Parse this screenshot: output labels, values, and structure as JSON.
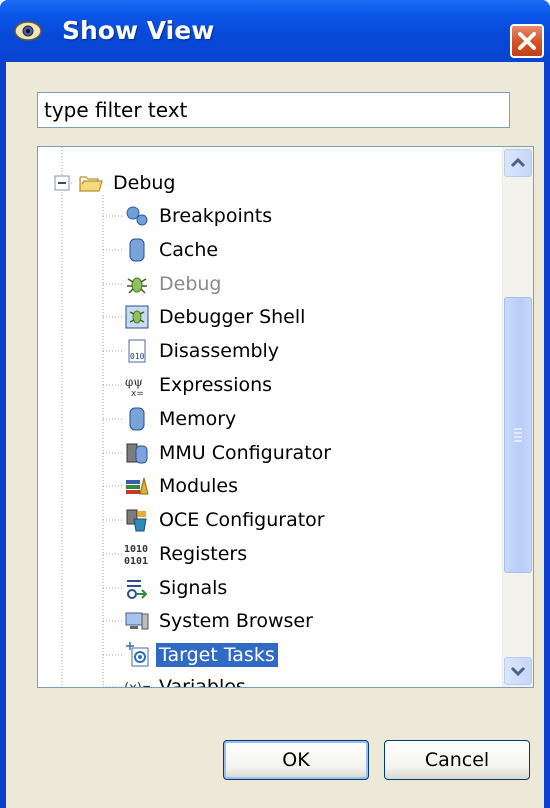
{
  "window": {
    "title": "Show View"
  },
  "filter": {
    "value": "type filter text"
  },
  "tree": {
    "root": "Debug",
    "items": [
      {
        "label": "Breakpoints",
        "icon": "breakpoints-icon"
      },
      {
        "label": "Cache",
        "icon": "cache-icon"
      },
      {
        "label": "Debug",
        "icon": "debug-bug-icon",
        "disabled": true
      },
      {
        "label": "Debugger Shell",
        "icon": "debugger-shell-icon"
      },
      {
        "label": "Disassembly",
        "icon": "disassembly-icon"
      },
      {
        "label": "Expressions",
        "icon": "expressions-icon"
      },
      {
        "label": "Memory",
        "icon": "memory-icon"
      },
      {
        "label": "MMU Configurator",
        "icon": "mmu-configurator-icon"
      },
      {
        "label": "Modules",
        "icon": "modules-icon"
      },
      {
        "label": "OCE Configurator",
        "icon": "oce-configurator-icon"
      },
      {
        "label": "Registers",
        "icon": "registers-icon"
      },
      {
        "label": "Signals",
        "icon": "signals-icon"
      },
      {
        "label": "System Browser",
        "icon": "system-browser-icon"
      },
      {
        "label": "Target Tasks",
        "icon": "target-tasks-icon",
        "selected": true
      },
      {
        "label": "Variables",
        "icon": "variables-icon"
      }
    ]
  },
  "buttons": {
    "ok": "OK",
    "cancel": "Cancel"
  },
  "colors": {
    "titlebar": "#0a44cf",
    "selection": "#316ac5",
    "dialog_bg": "#ece9d8",
    "close": "#d5542c"
  }
}
